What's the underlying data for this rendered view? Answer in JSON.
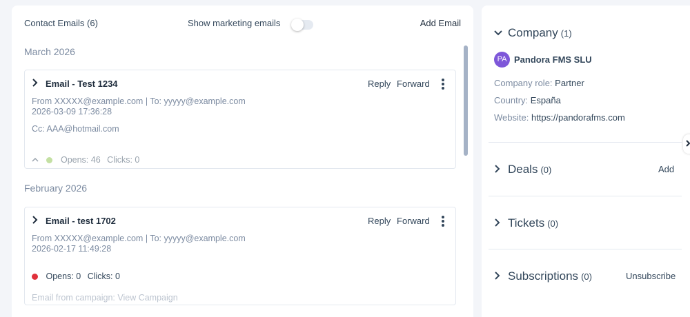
{
  "emails_panel": {
    "title": "Contact Emails (6)",
    "marketing_toggle_label": "Show marketing emails",
    "marketing_toggle_on": false,
    "add_email_label": "Add Email",
    "groups": [
      {
        "month": "March 2026",
        "emails": [
          {
            "subject": "Email - Test 1234",
            "reply": "Reply",
            "forward": "Forward",
            "from_to": "From XXXXX@example.com | To: yyyyy@example.com",
            "datetime": "2026-03-09 17:36:28",
            "cc": "Cc: AAA@hotmail.com",
            "opens": "Opens: 46",
            "clicks": "Clicks: 0",
            "status_color": "#8bc34a"
          }
        ]
      },
      {
        "month": "February 2026",
        "emails": [
          {
            "subject": "Email - test 1702",
            "reply": "Reply",
            "forward": "Forward",
            "from_to": "From XXXXX@example.com | To: yyyyy@example.com",
            "datetime": "2026-02-17 11:49:28",
            "opens": "Opens: 0",
            "clicks": "Clicks: 0",
            "status_color": "#e0303b",
            "campaign": "Email from campaign: View Campaign"
          }
        ]
      }
    ]
  },
  "sidebar": {
    "company": {
      "title": "Company",
      "count": "(1)",
      "avatar_initials": "PA",
      "avatar_color": "#7e57d9",
      "name": "Pandora FMS SLU",
      "role_key": "Company role:",
      "role_value": "Partner",
      "country_key": "Country:",
      "country_value": "España",
      "website_key": "Website:",
      "website_value": "https://pandorafms.com"
    },
    "deals": {
      "title": "Deals",
      "count": "(0)",
      "action": "Add"
    },
    "tickets": {
      "title": "Tickets",
      "count": "(0)"
    },
    "subscriptions": {
      "title": "Subscriptions",
      "count": "(0)",
      "action": "Unsubscribe"
    }
  }
}
